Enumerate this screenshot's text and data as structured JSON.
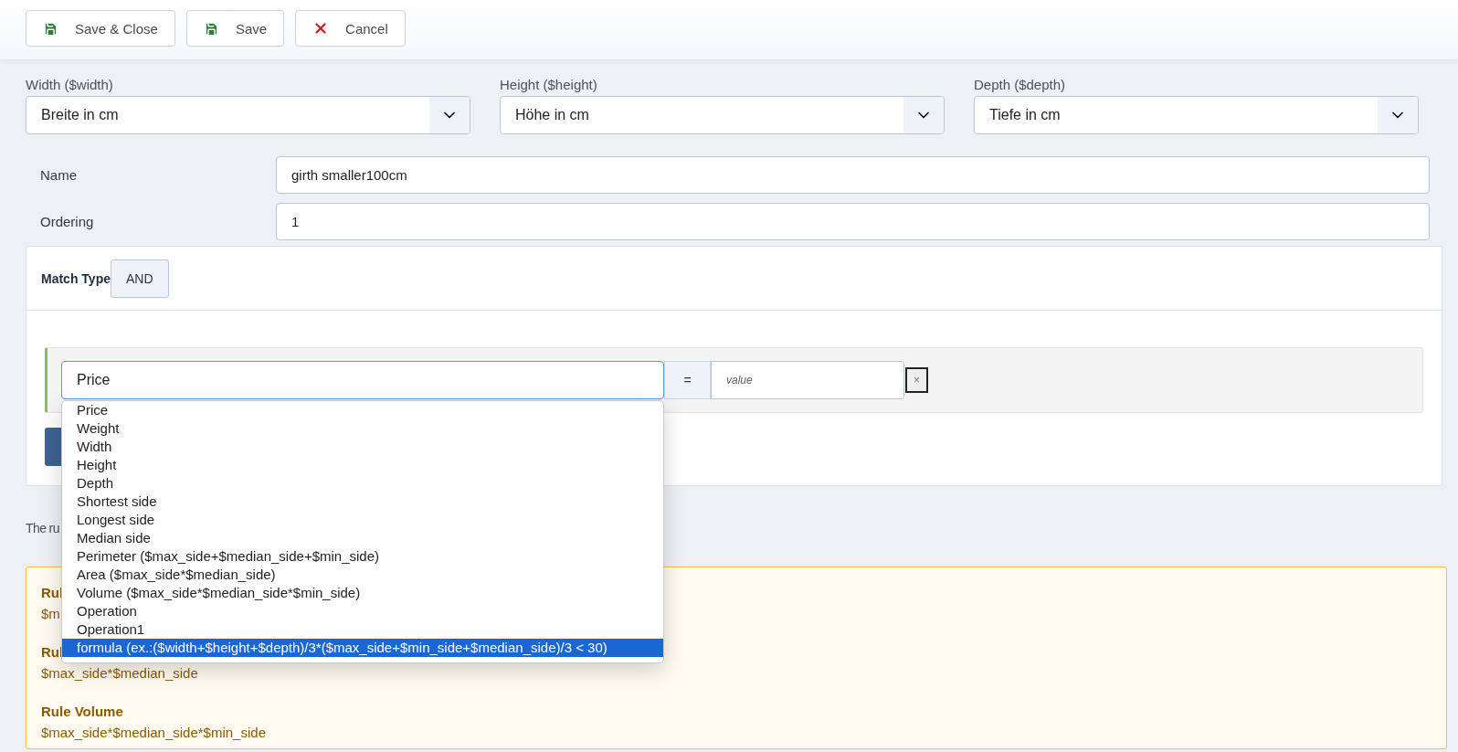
{
  "toolbar": {
    "buttons": [
      {
        "label": "Save & Close",
        "kind": "save"
      },
      {
        "label": "Save",
        "kind": "save"
      },
      {
        "label": "Cancel",
        "kind": "cancel"
      }
    ]
  },
  "dimension_selects": [
    {
      "label": "Width ($width)",
      "value": "Breite in cm"
    },
    {
      "label": "Height ($height)",
      "value": "Höhe in cm"
    },
    {
      "label": "Depth ($depth)",
      "value": "Tiefe in cm"
    }
  ],
  "fields": [
    {
      "label": "Name",
      "value": "girth smaller100cm"
    },
    {
      "label": "Ordering",
      "value": "1"
    }
  ],
  "match_type": {
    "label": "Match Type",
    "value": "AND"
  },
  "condition": {
    "field": "Price",
    "operator": "=",
    "placeholder": "value",
    "remove": "×",
    "options": [
      {
        "label": "Price",
        "selected": false
      },
      {
        "label": "Weight",
        "selected": false
      },
      {
        "label": "Width",
        "selected": false
      },
      {
        "label": "Height",
        "selected": false
      },
      {
        "label": "Depth",
        "selected": false
      },
      {
        "label": "Shortest side",
        "selected": false
      },
      {
        "label": "Longest side",
        "selected": false
      },
      {
        "label": "Median side",
        "selected": false
      },
      {
        "label": "Perimeter ($max_side+$median_side+$min_side)",
        "selected": false
      },
      {
        "label": "Area ($max_side*$median_side)",
        "selected": false
      },
      {
        "label": "Volume ($max_side*$median_side*$min_side)",
        "selected": false
      },
      {
        "label": "Operation",
        "selected": false
      },
      {
        "label": "Operation1",
        "selected": false
      },
      {
        "label": "formula (ex.:($width+$height+$depth)/3*($max_side+$min_side+$median_side)/3 < 30)",
        "selected": true
      }
    ]
  },
  "note": "The ru",
  "rules": [
    {
      "label": "Rul",
      "value": "$m"
    },
    {
      "label": "Rul",
      "value": "$max_side*$median_side"
    },
    {
      "label": "Rule Volume",
      "value": "$max_side*$median_side*$min_side"
    }
  ]
}
